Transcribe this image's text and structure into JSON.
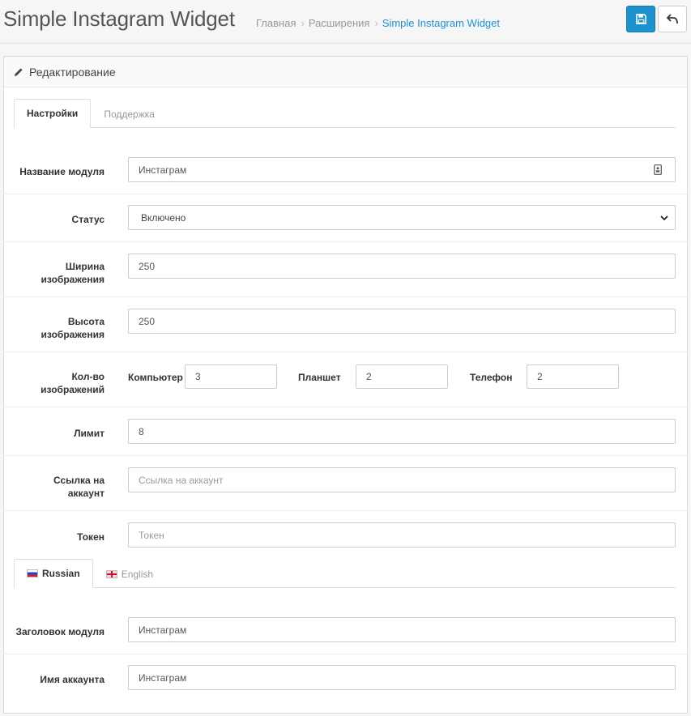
{
  "header": {
    "title": "Simple Instagram Widget",
    "breadcrumb": [
      "Главная",
      "Расширения",
      "Simple Instagram Widget"
    ],
    "save_icon": "save-icon",
    "back_icon": "reply-icon"
  },
  "panel": {
    "title": "Редактирование",
    "icon": "pencil-icon"
  },
  "tabs": [
    {
      "label": "Настройки",
      "active": true
    },
    {
      "label": "Поддержка",
      "active": false
    }
  ],
  "form": {
    "module_name": {
      "label": "Название модуля",
      "value": "Инстаграм"
    },
    "status": {
      "label": "Статус",
      "value": "Включено"
    },
    "image_width": {
      "label_line1": "Ширина",
      "label_line2": "изображения",
      "value": "250"
    },
    "image_height": {
      "label_line1": "Высота",
      "label_line2": "изображения",
      "value": "250"
    },
    "image_count": {
      "label_line1": "Кол-во",
      "label_line2": "изображений",
      "desktop": {
        "label": "Компьютер",
        "value": "3"
      },
      "tablet": {
        "label": "Планшет",
        "value": "2"
      },
      "phone": {
        "label": "Телефон",
        "value": "2"
      }
    },
    "limit": {
      "label": "Лимит",
      "value": "8"
    },
    "account_link": {
      "label_line1": "Ссылка на",
      "label_line2": "аккаунт",
      "placeholder": "Ссылка на аккаунт"
    },
    "token": {
      "label": "Токен",
      "placeholder": "Токен"
    }
  },
  "lang_tabs": [
    {
      "label": "Russian",
      "active": true
    },
    {
      "label": "English",
      "active": false
    }
  ],
  "lang_form": {
    "module_heading": {
      "label": "Заголовок модуля",
      "value": "Инстаграм"
    },
    "account_name": {
      "label": "Имя аккаунта",
      "value": "Инстаграм"
    }
  },
  "colors": {
    "primary": "#1e91cf",
    "background": "#f6f6f6"
  }
}
